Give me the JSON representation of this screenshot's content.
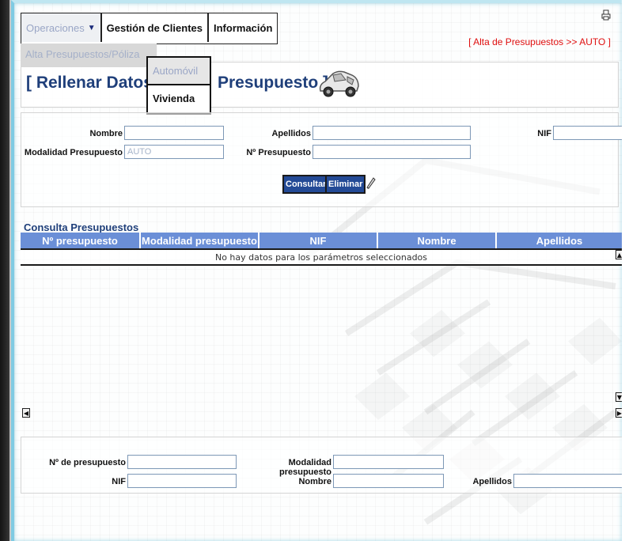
{
  "menu": {
    "operaciones": "Operaciones",
    "gestion_clientes": "Gestión de Clientes",
    "informacion": "Información"
  },
  "submenu": {
    "alta": "Alta Presupuestos/Póliza",
    "items": [
      "Automóvil",
      "Vivienda"
    ]
  },
  "breadcrumb": "[ Alta de Presupuestos >> AUTO ]",
  "title": {
    "left": "[ Rellenar Datos N",
    "right": "Presupuesto ]"
  },
  "form": {
    "nombre_label": "Nombre",
    "apellidos_label": "Apellidos",
    "nif_label": "NIF",
    "modalidad_label": "Modalidad Presupuesto",
    "modalidad_value": "AUTO",
    "npresupuesto_label": "Nº Presupuesto",
    "consultar": "Consultar",
    "eliminar": "Eliminar"
  },
  "table": {
    "title": "Consulta Presupuestos",
    "columns": [
      "Nº presupuesto",
      "Modalidad presupuesto",
      "NIF",
      "Nombre",
      "Apellidos"
    ],
    "empty_message": "No hay datos para los parámetros seleccionados"
  },
  "bottom": {
    "npresupuesto_label": "Nº de presupuesto",
    "modalidad_label": "Modalidad presupuesto",
    "nif_label": "NIF",
    "nombre_label": "Nombre",
    "apellidos_label": "Apellidos"
  },
  "colors": {
    "breadcrumb": "#e01010",
    "title": "#1f3f7a",
    "header": "#6b8fd7",
    "button": "#234a96"
  }
}
